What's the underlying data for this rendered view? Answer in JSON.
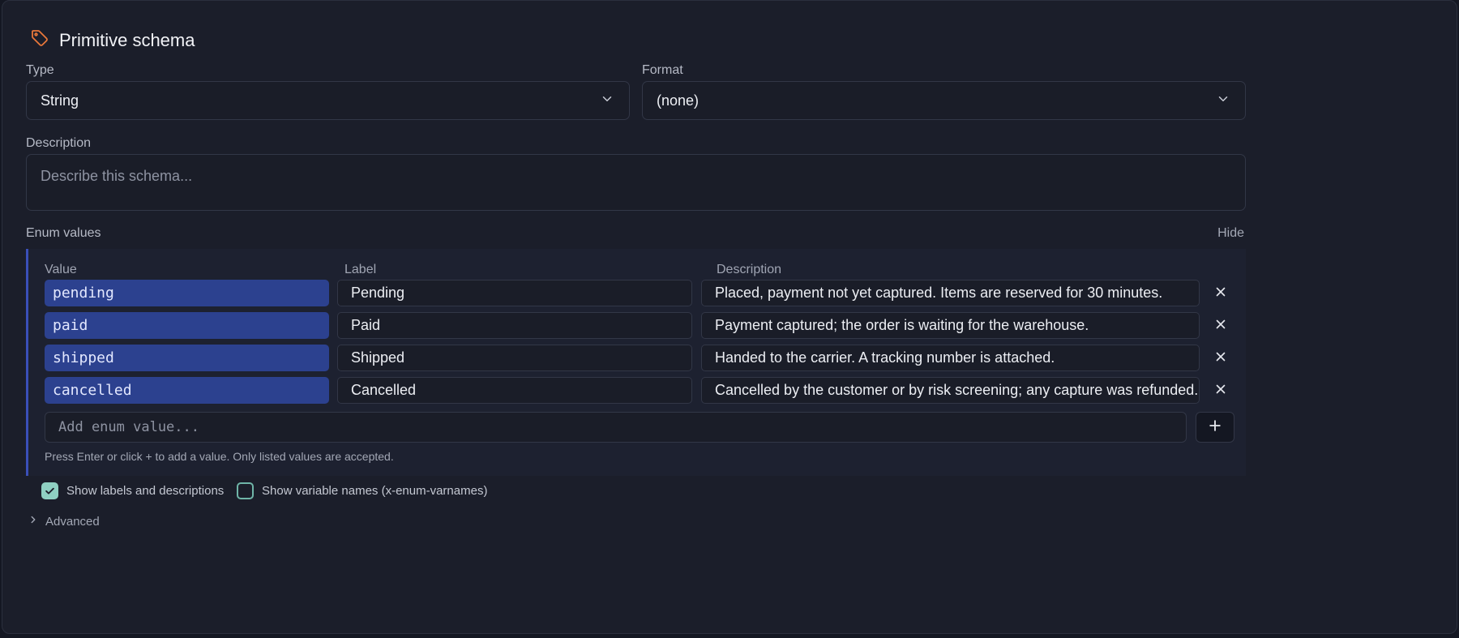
{
  "header": {
    "title": "Primitive schema",
    "icon": "tag-icon",
    "icon_color": "#e8773a"
  },
  "type_field": {
    "label": "Type",
    "value": "String"
  },
  "format_field": {
    "label": "Format",
    "value": "(none)"
  },
  "description_field": {
    "label": "Description",
    "placeholder": "Describe this schema..."
  },
  "enum": {
    "section_label": "Enum values",
    "hide_label": "Hide",
    "columns": {
      "value": "Value",
      "label": "Label",
      "description": "Description"
    },
    "rows": [
      {
        "value": "pending",
        "label": "Pending",
        "description": "Placed, payment not yet captured. Items are reserved for 30 minutes."
      },
      {
        "value": "paid",
        "label": "Paid",
        "description": "Payment captured; the order is waiting for the warehouse."
      },
      {
        "value": "shipped",
        "label": "Shipped",
        "description": "Handed to the carrier. A tracking number is attached."
      },
      {
        "value": "cancelled",
        "label": "Cancelled",
        "description": "Cancelled by the customer or by risk screening; any capture was refunded."
      }
    ],
    "add_placeholder": "Add enum value...",
    "hint": "Press Enter or click + to add a value. Only listed values are accepted."
  },
  "options": {
    "show_labels": {
      "label": "Show labels and descriptions",
      "checked": true
    },
    "show_varnames": {
      "label": "Show variable names (x-enum-varnames)",
      "checked": false
    }
  },
  "advanced": {
    "label": "Advanced"
  },
  "colors": {
    "accent": "#3a4fb8",
    "chip": "#2c418f",
    "check": "#8fd0c2"
  }
}
